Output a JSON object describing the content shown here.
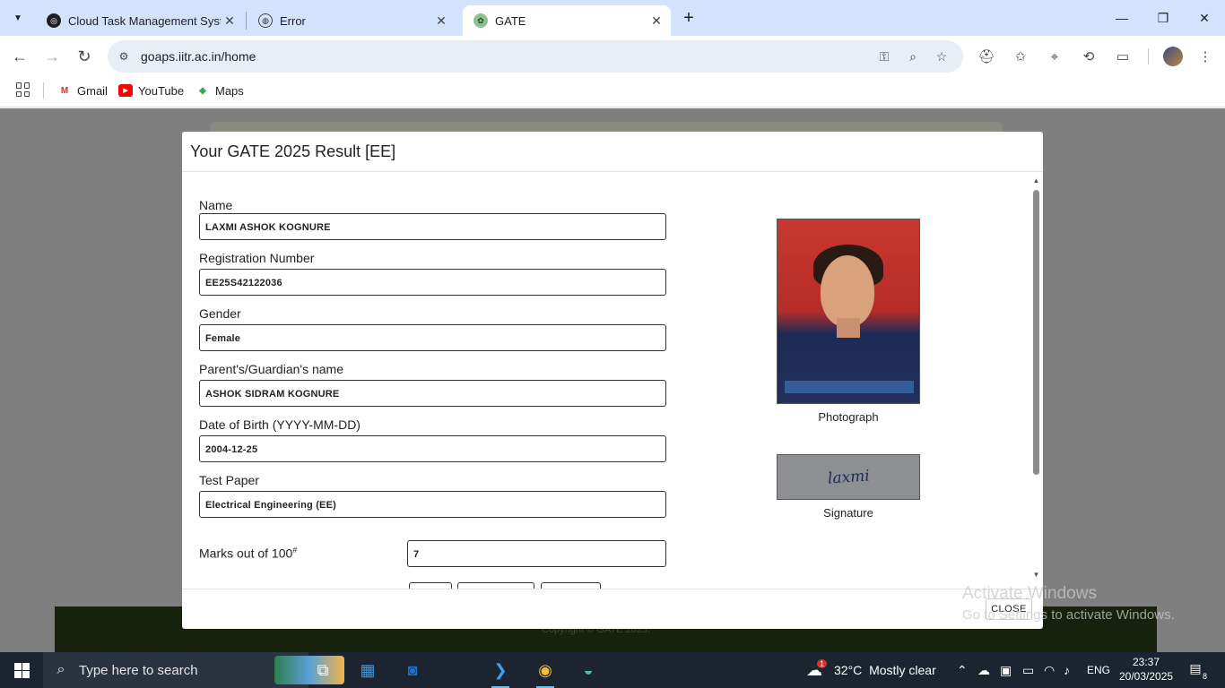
{
  "browser": {
    "tabs": [
      {
        "title": "Cloud Task Management System",
        "icon": "cloud-app-icon",
        "active": false
      },
      {
        "title": "Error",
        "icon": "globe-icon",
        "active": false
      },
      {
        "title": "GATE",
        "icon": "gate-logo-icon",
        "active": true
      }
    ],
    "url": "goaps.iitr.ac.in/home",
    "bookmarks": [
      {
        "label": "Gmail",
        "icon": "gmail-icon"
      },
      {
        "label": "YouTube",
        "icon": "youtube-icon"
      },
      {
        "label": "Maps",
        "icon": "maps-icon"
      }
    ]
  },
  "modal": {
    "title": "Your GATE 2025 Result [EE]",
    "fields": [
      {
        "label": "Name",
        "value": "LAXMI ASHOK KOGNURE"
      },
      {
        "label": "Registration Number",
        "value": "EE25S42122036"
      },
      {
        "label": "Gender",
        "value": "Female"
      },
      {
        "label": "Parent's/Guardian's name",
        "value": "ASHOK SIDRAM KOGNURE"
      },
      {
        "label": "Date of Birth (YYYY-MM-DD)",
        "value": "2004-12-25"
      },
      {
        "label": "Test Paper",
        "value": "Electrical Engineering (EE)"
      }
    ],
    "marks": {
      "label": "Marks out of 100",
      "sup": "#",
      "value": "7"
    },
    "photo_caption": "Photograph",
    "signature_caption": "Signature",
    "signature_text": "laxmi",
    "close_label": "CLOSE"
  },
  "page": {
    "footer_text": "Copyright © GATE 2025."
  },
  "watermark": {
    "line1": "Activate Windows",
    "line2": "Go to Settings to activate Windows."
  },
  "taskbar": {
    "search_placeholder": "Type here to search",
    "weather": "32°C  Mostly clear",
    "language": "ENG",
    "time": "23:37",
    "date": "20/03/2025",
    "notification_count": "8",
    "weather_badge": "1"
  },
  "colors": {
    "tabstrip": "#d3e3fd",
    "overlay": "#7f7f7f",
    "taskbar": "#1b2430"
  }
}
